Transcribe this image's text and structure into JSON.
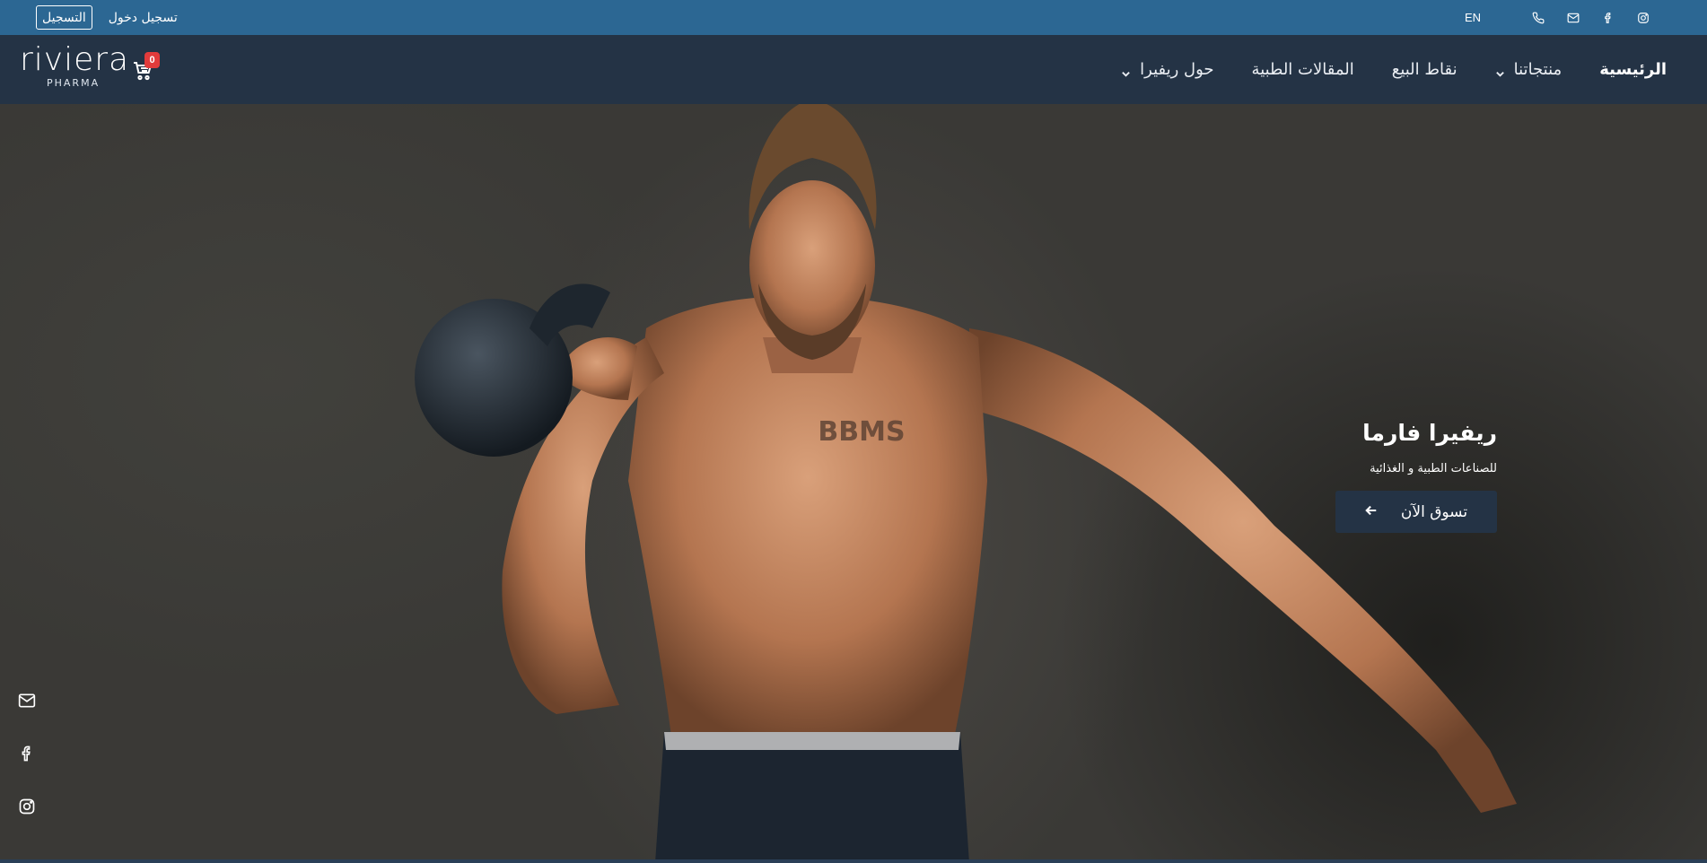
{
  "topbar": {
    "register_label": "التسجيل",
    "login_label": "تسجيل دخول",
    "language_label": "EN",
    "icons": [
      "phone-icon",
      "mail-icon",
      "facebook-icon",
      "instagram-icon"
    ],
    "background_color": "#2c6793"
  },
  "navbar": {
    "logo_text": "riviera",
    "logo_subtext": "PHARMA",
    "cart_count": "0",
    "items": [
      {
        "label": "الرئيسية",
        "active": true,
        "has_dropdown": false
      },
      {
        "label": "منتجاتنا",
        "active": false,
        "has_dropdown": true
      },
      {
        "label": "نقاط البيع",
        "active": false,
        "has_dropdown": false
      },
      {
        "label": "المقالات الطبية",
        "active": false,
        "has_dropdown": false
      },
      {
        "label": "حول ريفيرا",
        "active": false,
        "has_dropdown": true
      }
    ],
    "background_color": "#243345"
  },
  "hero": {
    "title": "ريفيرا فارما",
    "subtitle": "للصناعات الطبية و الغذائية",
    "cta_label": "تسوق الآن",
    "chest_text": "BBMS",
    "side_social_icons": [
      "mail-icon",
      "facebook-icon",
      "instagram-icon"
    ]
  }
}
